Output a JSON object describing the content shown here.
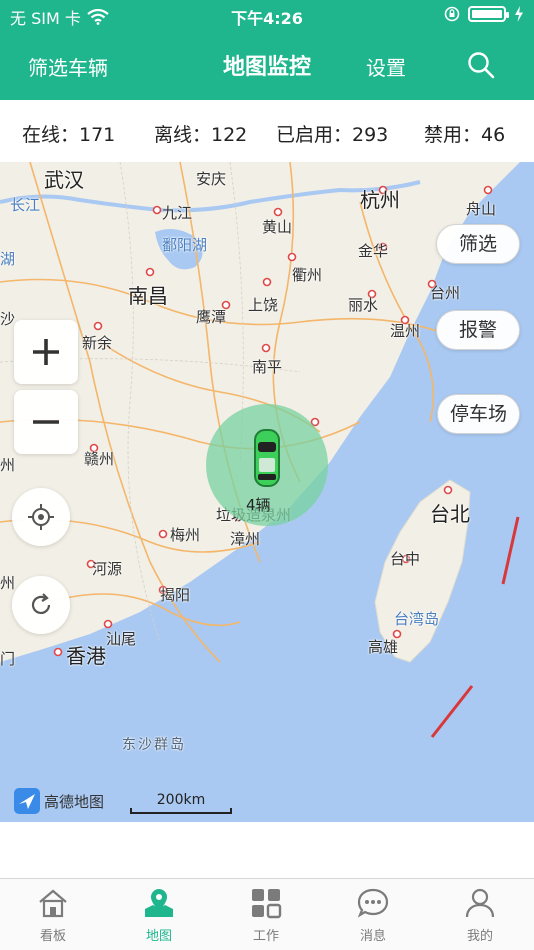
{
  "status_bar": {
    "carrier": "无 SIM 卡",
    "time": "下午4:26",
    "battery_level": 1.0
  },
  "nav": {
    "filter_label": "筛选车辆",
    "title": "地图监控",
    "settings_label": "设置",
    "search_icon": "search-icon"
  },
  "stats": {
    "online": "在线：171",
    "offline": "离线：122",
    "enabled": "已启用：293",
    "disabled": "禁用：46"
  },
  "map": {
    "places": {
      "wuhan": "武汉",
      "anqing": "安庆",
      "hangzhou": "杭州",
      "zhoushan": "舟山",
      "changjiang": "长江",
      "jiujiang": "九江",
      "huangshan": "黄山",
      "poyanghu": "鄱阳湖",
      "jinhua": "金华",
      "hu": "湖",
      "quzhou": "衢州",
      "taizhou": "台州",
      "nanchang": "南昌",
      "shangrao": "上饶",
      "lishui": "丽水",
      "sha": "沙",
      "yingtan": "鹰潭",
      "wenzhou": "温州",
      "xinyu": "新余",
      "nanping": "南平",
      "ganzhou": "赣州",
      "zhou": "州",
      "taibei": "台北",
      "meizhou": "梅州",
      "zhangzhou": "漳州",
      "taizhong": "台中",
      "heyuan": "河源",
      "zhou2": "州",
      "jieyang": "揭阳",
      "taiwanisland": "台湾岛",
      "shanwei": "汕尾",
      "men": "门",
      "xianggang": "香港",
      "gaoxiong": "高雄",
      "dongsha": "东沙群岛"
    },
    "side_buttons": [
      "筛选",
      "报警",
      "停车场"
    ],
    "cluster_label": "4辆",
    "cluster_under_text": "垃圾造泉州",
    "logo_text": "高德地图",
    "scale_label": "200km"
  },
  "tabs": [
    {
      "label": "看板",
      "icon": "house-icon",
      "active": false
    },
    {
      "label": "地图",
      "icon": "map-pin-icon",
      "active": true
    },
    {
      "label": "工作",
      "icon": "grid-icon",
      "active": false
    },
    {
      "label": "消息",
      "icon": "chat-bubble-icon",
      "active": false
    },
    {
      "label": "我的",
      "icon": "person-icon",
      "active": false
    }
  ],
  "colors": {
    "brand": "#1fb68e",
    "sea": "#a9c9f2",
    "road": "#f4b66a",
    "tab_inactive": "#7b7b7b"
  }
}
